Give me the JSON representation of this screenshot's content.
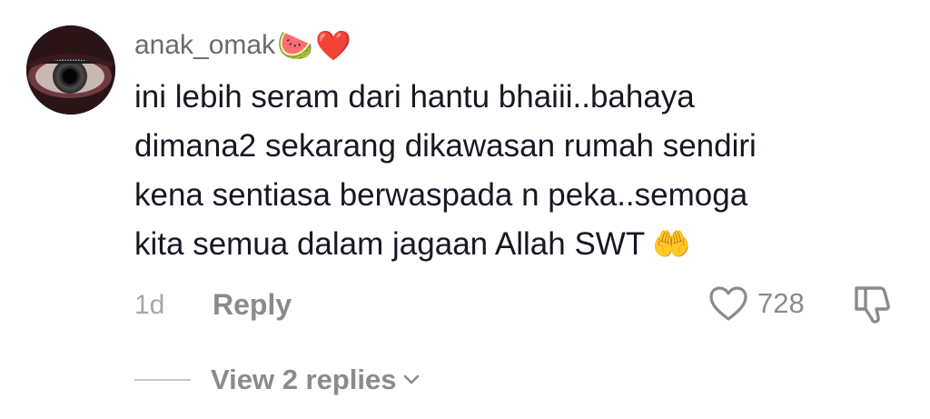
{
  "comment": {
    "username": "anak_omak",
    "username_emojis": [
      "🍉",
      "❤️"
    ],
    "avatar_icon": "eye-photo-avatar",
    "text_lines": [
      "ini lebih seram dari hantu bhaiii..bahaya",
      "dimana2 sekarang dikawasan rumah sendiri",
      "kena sentiasa berwaspada n peka..semoga",
      "kita semua dalam jagaan Allah SWT"
    ],
    "text_emoji": "🤲",
    "time": "1d",
    "reply_label": "Reply",
    "likes": "728",
    "view_replies_label": "View 2 replies"
  },
  "colors": {
    "text": "#161823",
    "muted": "#8a8a8f",
    "time": "#a6a6aa",
    "username": "#6a6a6f"
  }
}
